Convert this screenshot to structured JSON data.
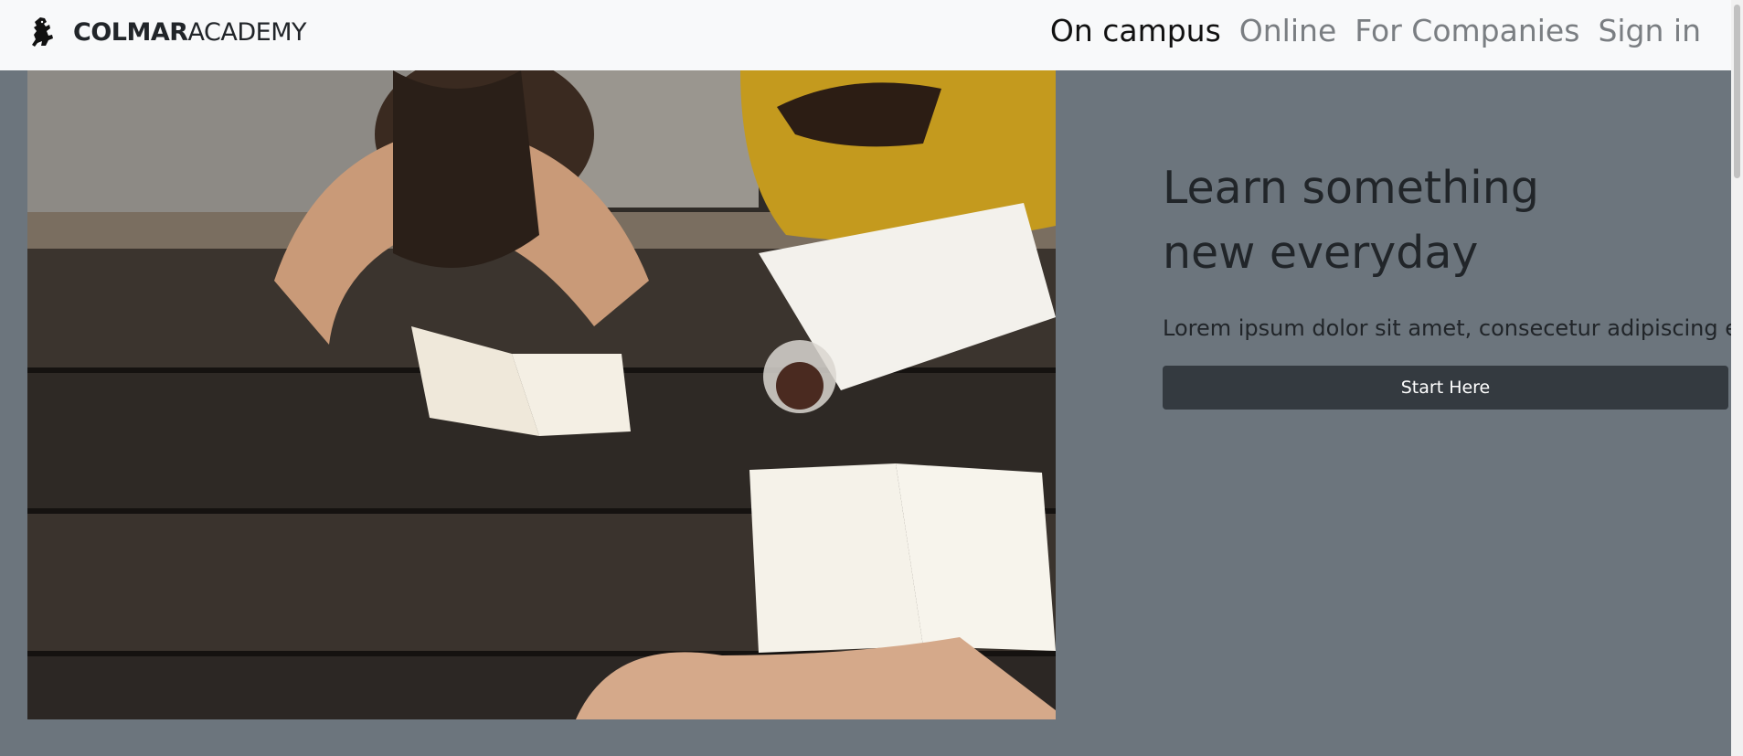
{
  "navbar": {
    "brand_bold": "COLMAR",
    "brand_rest": "ACADEMY",
    "links": [
      {
        "label": "On campus",
        "active": true
      },
      {
        "label": "Online",
        "active": false
      },
      {
        "label": "For Companies",
        "active": false
      },
      {
        "label": "Sign in",
        "active": false
      }
    ]
  },
  "hero": {
    "title_line1": "Learn something",
    "title_line2": "new everyday",
    "lead": "Lorem ipsum dolor sit amet, consecetur adipiscing elit.",
    "button_label": "Start Here"
  },
  "icons": {
    "brand": "lion-rampant-icon"
  },
  "colors": {
    "navbar_bg": "#f8f9fa",
    "page_bg": "#6c757d",
    "button_bg": "#343a40",
    "nav_active": "#111111",
    "nav_inactive": "#7a7e82"
  }
}
